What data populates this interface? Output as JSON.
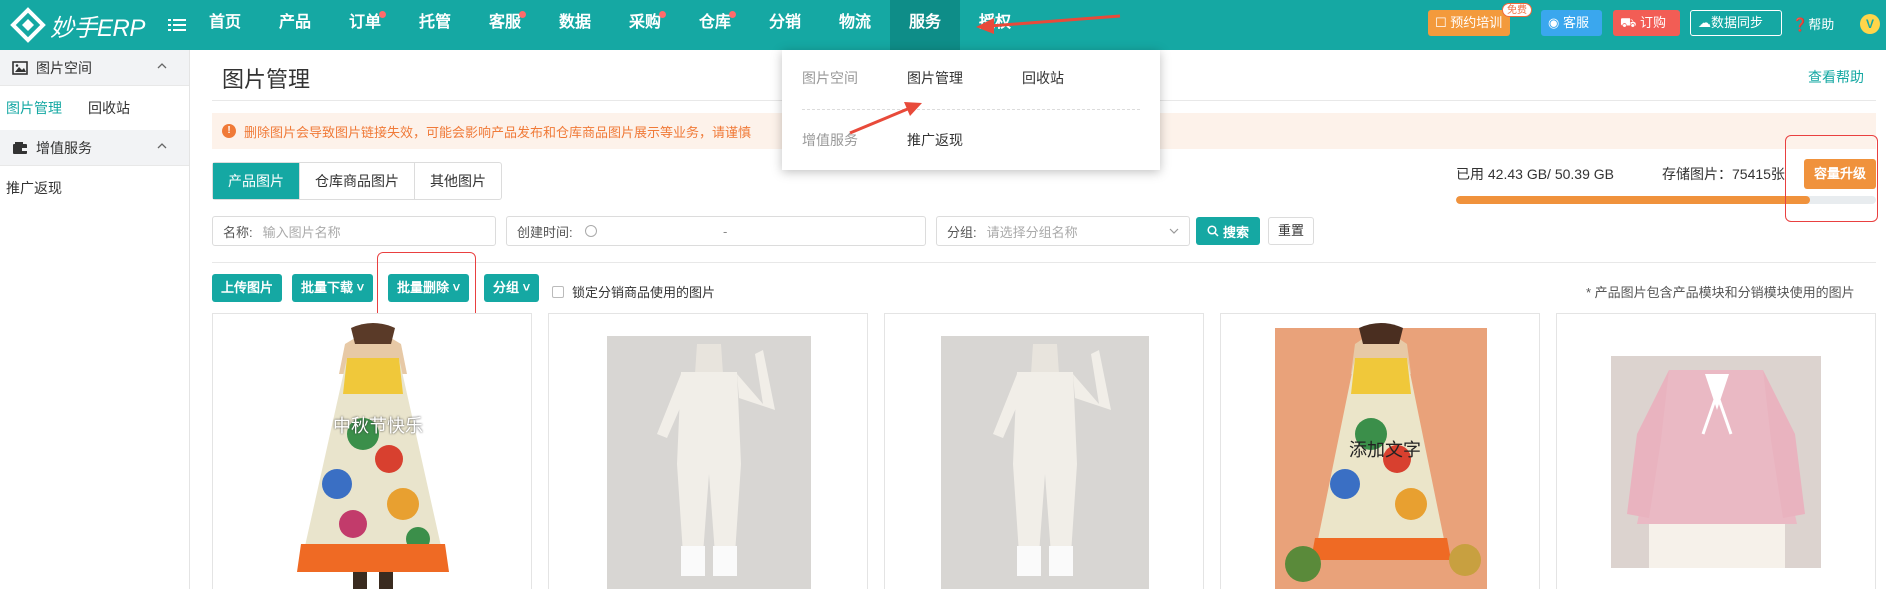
{
  "brand": {
    "name": "妙手ERP",
    "menu_icon": "menu-list-icon",
    "color": "#15a8a3"
  },
  "nav": {
    "items": [
      {
        "label": "首页",
        "dot": false
      },
      {
        "label": "产品",
        "dot": false
      },
      {
        "label": "订单",
        "dot": true
      },
      {
        "label": "托管",
        "dot": false
      },
      {
        "label": "客服",
        "dot": true
      },
      {
        "label": "数据",
        "dot": false
      },
      {
        "label": "采购",
        "dot": true
      },
      {
        "label": "仓库",
        "dot": true
      },
      {
        "label": "分销",
        "dot": false
      },
      {
        "label": "物流",
        "dot": false
      },
      {
        "label": "服务",
        "dot": false,
        "active": true
      },
      {
        "label": "授权",
        "dot": false
      }
    ]
  },
  "top_actions": {
    "training": "预约培训",
    "free_tag": "免费",
    "service": "客服",
    "order": "订购",
    "sync": "数据同步",
    "help": "帮助",
    "avatar": "V"
  },
  "sidebar": {
    "groups": [
      {
        "title": "图片空间",
        "icon": "image-icon",
        "links": [
          {
            "label": "图片管理",
            "active": true
          },
          {
            "label": "回收站",
            "active": false
          }
        ]
      },
      {
        "title": "增值服务",
        "icon": "wallet-icon",
        "links": [
          {
            "label": "推广返现",
            "active": false
          }
        ]
      }
    ]
  },
  "dropdown": {
    "rows": [
      {
        "category": "图片空间",
        "items": [
          "图片管理",
          "回收站"
        ]
      },
      {
        "category": "增值服务",
        "items": [
          "推广返现"
        ]
      }
    ]
  },
  "page": {
    "title": "图片管理",
    "help_link": "查看帮助",
    "warning": "删除图片会导致图片链接失效，可能会影响产品发布和仓库商品图片展示等业务，请谨慎"
  },
  "tabs": [
    {
      "label": "产品图片",
      "active": true
    },
    {
      "label": "仓库商品图片",
      "active": false
    },
    {
      "label": "其他图片",
      "active": false
    }
  ],
  "storage": {
    "usage_text": "已用 42.43 GB/ 50.39 GB",
    "count_text": "存储图片：75415张",
    "used_fraction": 0.842,
    "upgrade_label": "容量升级"
  },
  "filters": {
    "name_label": "名称:",
    "name_placeholder": "输入图片名称",
    "time_label": "创建时间:",
    "time_sep": "-",
    "group_label": "分组:",
    "group_placeholder": "请选择分组名称",
    "search_label": "搜索",
    "reset_label": "重置"
  },
  "actions": {
    "upload": "上传图片",
    "batch_download": "批量下载",
    "batch_delete": "批量删除",
    "group": "分组",
    "lock_label": "锁定分销商品使用的图片",
    "note": "* 产品图片包含产品模块和分销模块使用的图片"
  },
  "images": [
    {
      "kind": "dress",
      "overlay": "中秋节快乐"
    },
    {
      "kind": "jumpsuit",
      "overlay": ""
    },
    {
      "kind": "jumpsuit",
      "overlay": ""
    },
    {
      "kind": "dress-orange",
      "overlay": "添加文字"
    },
    {
      "kind": "sweater",
      "overlay": ""
    }
  ]
}
